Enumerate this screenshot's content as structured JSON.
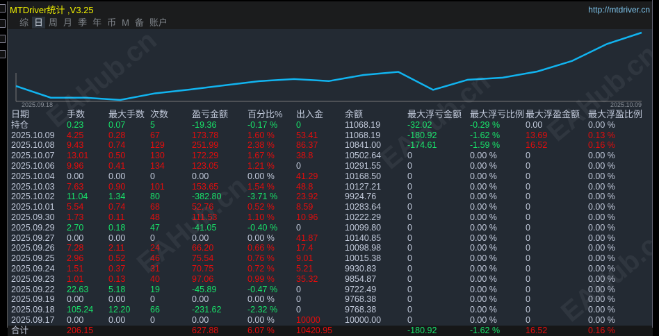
{
  "title": "MTDriver统计 ,V3.25",
  "url": "http://mtdriver.cn",
  "tabs": [
    "综",
    "日",
    "周",
    "月",
    "季",
    "年",
    "币",
    "M",
    "备",
    "账户"
  ],
  "selected_tab": 1,
  "watermark": "EAHub.cn",
  "colors": {
    "green": "#18e36a",
    "red": "#e50c0c",
    "text": "#c2cadb",
    "line": "#11b4f0",
    "title": "#f5f500"
  },
  "chart_data": {
    "type": "line",
    "x_start_label": "2025.09.18",
    "x_end_label": "2025.10.09",
    "series": [
      {
        "name": "余额",
        "values": [
          10000,
          9768.38,
          9768.38,
          9722.49,
          9854.87,
          9930.83,
          10015.38,
          10098.98,
          10140.85,
          10099.8,
          10222.29,
          10283.64,
          9924.76,
          10127.21,
          10168.5,
          10291.55,
          10502.64,
          10841.0,
          11068.19
        ]
      }
    ]
  },
  "table": {
    "headers": [
      "日期",
      "手数",
      "最大手数",
      "次数",
      "盈亏金额",
      "百分比%",
      "出入金",
      "余额",
      "最大浮亏金额",
      "最大浮亏比例",
      "最大浮盈金额",
      "最大浮盈比例"
    ],
    "rows": [
      {
        "cells": [
          "持仓",
          "0.23",
          "0.07",
          "5",
          "-19.36",
          "-0.17 %",
          "0",
          "11068.19",
          "-32.02",
          "-0.29 %",
          "0.00",
          "0.00 %"
        ],
        "tones": "wggggggwggww"
      },
      {
        "cells": [
          "2025.10.09",
          "4.25",
          "0.28",
          "67",
          "173.78",
          "1.60 %",
          "53.41",
          "11068.19",
          "-180.92",
          "-1.62 %",
          "13.69",
          "0.13 %"
        ],
        "tones": "wrrrrrrwggrr"
      },
      {
        "cells": [
          "2025.10.08",
          "9.43",
          "0.74",
          "129",
          "251.99",
          "2.38 %",
          "86.37",
          "10841.00",
          "-174.61",
          "-1.59 %",
          "16.52",
          "0.16 %"
        ],
        "tones": "wrrrrrrwggrr"
      },
      {
        "cells": [
          "2025.10.07",
          "13.01",
          "0.50",
          "130",
          "172.29",
          "1.67 %",
          "38.8",
          "10502.64",
          "0",
          "0.00 %",
          "0",
          "0.00 %"
        ],
        "tones": "wrrrrrrwwwww"
      },
      {
        "cells": [
          "2025.10.06",
          "9.96",
          "0.41",
          "134",
          "123.05",
          "1.21 %",
          "0",
          "10291.55",
          "0",
          "0.00 %",
          "0",
          "0.00 %"
        ],
        "tones": "wrrrrrwwwwww"
      },
      {
        "cells": [
          "2025.10.04",
          "0.00",
          "0.00",
          "0",
          "0.00",
          "0.00 %",
          "41.29",
          "10168.50",
          "0",
          "0.00 %",
          "0",
          "0.00 %"
        ],
        "tones": "wwwwwwrwwwww"
      },
      {
        "cells": [
          "2025.10.03",
          "7.63",
          "0.90",
          "101",
          "153.65",
          "1.54 %",
          "48.8",
          "10127.21",
          "0",
          "0.00 %",
          "0",
          "0.00 %"
        ],
        "tones": "wrrrrrrwwwww"
      },
      {
        "cells": [
          "2025.10.02",
          "11.04",
          "1.34",
          "80",
          "-382.80",
          "-3.71 %",
          "23.92",
          "9924.76",
          "0",
          "0.00 %",
          "0",
          "0.00 %"
        ],
        "tones": "wgggggrwwwww"
      },
      {
        "cells": [
          "2025.10.01",
          "5.54",
          "0.74",
          "68",
          "52.76",
          "0.52 %",
          "8.59",
          "10283.64",
          "0",
          "0.00 %",
          "0",
          "0.00 %"
        ],
        "tones": "wrrrrrrwwwww"
      },
      {
        "cells": [
          "2025.09.30",
          "1.73",
          "0.11",
          "48",
          "111.53",
          "1.10 %",
          "10.96",
          "10222.29",
          "0",
          "0.00 %",
          "0",
          "0.00 %"
        ],
        "tones": "wrrrrrrwwwww"
      },
      {
        "cells": [
          "2025.09.29",
          "2.70",
          "0.18",
          "47",
          "-41.05",
          "-0.40 %",
          "0",
          "10099.80",
          "0",
          "0.00 %",
          "0",
          "0.00 %"
        ],
        "tones": "wgggggwwwwww"
      },
      {
        "cells": [
          "2025.09.27",
          "0.00",
          "0.00",
          "0",
          "0.00",
          "0.00 %",
          "41.87",
          "10140.85",
          "0",
          "0.00 %",
          "0",
          "0.00 %"
        ],
        "tones": "wwwwwwrwwwww"
      },
      {
        "cells": [
          "2025.09.26",
          "7.28",
          "2.11",
          "24",
          "66.20",
          "0.66 %",
          "17.4",
          "10098.98",
          "0",
          "0.00 %",
          "0",
          "0.00 %"
        ],
        "tones": "wrrrrrrwwwww"
      },
      {
        "cells": [
          "2025.09.25",
          "2.96",
          "0.52",
          "46",
          "75.54",
          "0.76 %",
          "9.01",
          "10015.38",
          "0",
          "0.00 %",
          "0",
          "0.00 %"
        ],
        "tones": "wrrrrrrwwwww"
      },
      {
        "cells": [
          "2025.09.24",
          "1.51",
          "0.37",
          "31",
          "70.75",
          "0.72 %",
          "5.21",
          "9930.83",
          "0",
          "0.00 %",
          "0",
          "0.00 %"
        ],
        "tones": "wrrrrrrwwwww"
      },
      {
        "cells": [
          "2025.09.23",
          "1.01",
          "0.13",
          "40",
          "97.06",
          "0.99 %",
          "35.32",
          "9854.87",
          "0",
          "0.00 %",
          "0",
          "0.00 %"
        ],
        "tones": "wrrrrrrwwwww"
      },
      {
        "cells": [
          "2025.09.22",
          "22.63",
          "5.18",
          "19",
          "-45.89",
          "-0.47 %",
          "0",
          "9722.49",
          "0",
          "0.00 %",
          "0",
          "0.00 %"
        ],
        "tones": "wgggggwwwwww"
      },
      {
        "cells": [
          "2025.09.19",
          "0.00",
          "0.00",
          "0",
          "0.00",
          "0.00 %",
          "0",
          "9768.38",
          "0",
          "0.00 %",
          "0",
          "0.00 %"
        ],
        "tones": "wwwwwwwwwwww"
      },
      {
        "cells": [
          "2025.09.18",
          "105.24",
          "12.20",
          "66",
          "-231.62",
          "-2.32 %",
          "0",
          "9768.38",
          "0",
          "0.00 %",
          "0",
          "0.00 %"
        ],
        "tones": "wgggggwwwwww"
      },
      {
        "cells": [
          "2025.09.17",
          "0.00",
          "0.00",
          "0",
          "0.00",
          "0.00 %",
          "10000",
          "10000.00",
          "0",
          "0.00 %",
          "0",
          "0.00 %"
        ],
        "tones": "wwwwwwrwwwww"
      }
    ],
    "total": {
      "cells": [
        "合计",
        "206.15",
        "",
        "",
        "627.88",
        "6.07 %",
        "10420.95",
        "",
        "-180.92",
        "-1.62 %",
        "16.52",
        "0.16 %"
      ],
      "tones": "wrwwrrrwggrr"
    }
  }
}
